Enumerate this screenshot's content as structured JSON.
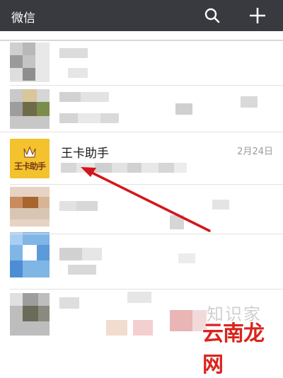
{
  "header": {
    "title": "微信",
    "search_icon": "search-icon",
    "add_icon": "plus-icon"
  },
  "pinned_chat": {
    "name": "王卡助手",
    "time": "2月24日",
    "avatar_text": "王卡助手"
  },
  "watermarks": {
    "site_small": "知识家",
    "site_large": "云南龙网"
  },
  "colors": {
    "topbar": "#393a3f",
    "arrow": "#d4161b",
    "avatar_bg": "#f3c22c"
  }
}
